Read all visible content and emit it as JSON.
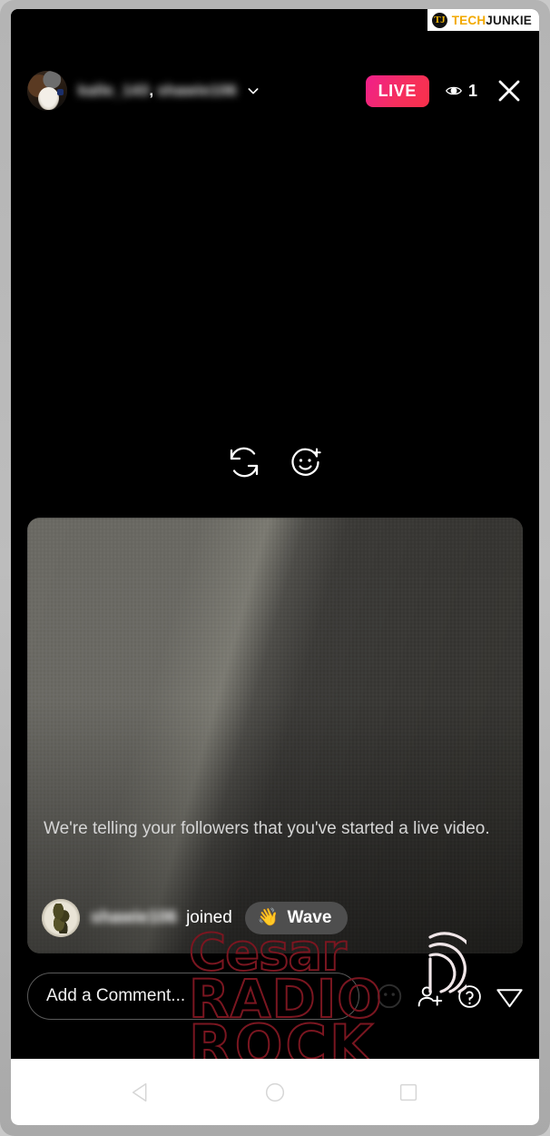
{
  "watermark_brand": {
    "badge_letters": "TJ",
    "word_one": "TECH",
    "word_two": "JUNKIE"
  },
  "header": {
    "avatar_name": "broadcaster-avatar",
    "username_primary": "kalle_143",
    "username_separator": ",",
    "username_secondary": "shawie106",
    "chevron_icon": "chevron-down-icon",
    "live_label": "LIVE",
    "viewer_icon": "eye-icon",
    "viewer_count": "1",
    "close_icon": "close-icon"
  },
  "camera_controls": [
    {
      "name": "flip-camera-icon",
      "label": "Flip camera"
    },
    {
      "name": "face-filter-icon",
      "label": "Effects"
    }
  ],
  "preview_card": {
    "notice_text": "We're telling your followers that you've started a live video.",
    "join_event": {
      "avatar_name": "viewer-avatar",
      "username": "shawie106",
      "verb": "joined",
      "wave_emoji": "👋",
      "wave_label": "Wave"
    }
  },
  "bottom_bar": {
    "comment_placeholder": "Add a Comment...",
    "actions": [
      {
        "name": "emoji-sticker-icon",
        "label": "Stickers"
      },
      {
        "name": "add-person-icon",
        "label": "Add guest"
      },
      {
        "name": "questions-icon",
        "label": "Questions"
      },
      {
        "name": "send-icon",
        "label": "Send"
      }
    ]
  },
  "overlay_watermark": {
    "line_one": "Cesar",
    "line_two": "RADIO",
    "line_three": "ROCK",
    "signal_icon": "signal-waves-icon",
    "color": "#7a1620"
  },
  "android_nav": {
    "back": "back-triangle-icon",
    "home": "home-circle-icon",
    "recents": "recents-square-icon"
  },
  "colors": {
    "live_badge_start": "#f01f8c",
    "live_badge_end": "#f9304a",
    "stage_background": "#000000",
    "wave_pill": "#4e4e4e",
    "nav_bar": "#ffffff",
    "device_frame": "#b4b4b4"
  }
}
